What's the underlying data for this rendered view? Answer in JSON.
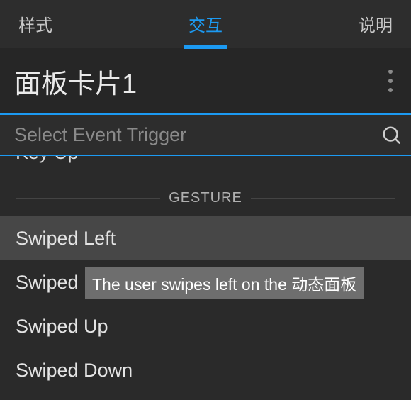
{
  "tabs": {
    "style": "样式",
    "interaction": "交互",
    "notes": "说明",
    "active_index": 1
  },
  "header": {
    "title": "面板卡片1"
  },
  "search": {
    "placeholder": "Select Event Trigger",
    "value": ""
  },
  "peek_item_above": "Key Up",
  "section": {
    "label": "GESTURE",
    "items": [
      {
        "label": "Swiped Left",
        "hovered": true
      },
      {
        "label": "Swiped Right",
        "hovered": false
      },
      {
        "label": "Swiped Up",
        "hovered": false
      },
      {
        "label": "Swiped Down",
        "hovered": false
      }
    ]
  },
  "tooltip": "The user swipes left on the 动态面板"
}
